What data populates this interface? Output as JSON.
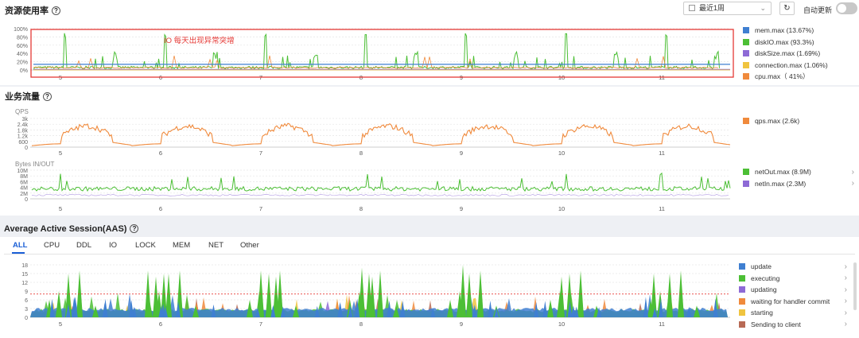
{
  "header": {
    "title": "资源使用率",
    "time_range": "最近1周",
    "auto_refresh_label": "自动更新"
  },
  "resource": {
    "annotation": "IO 每天出现异常突增",
    "y_ticks": [
      "100%",
      "80%",
      "60%",
      "40%",
      "20%",
      "0%"
    ],
    "x_ticks": [
      "5",
      "6",
      "7",
      "8",
      "9",
      "10",
      "11"
    ],
    "legend": [
      {
        "label": "mem.max (13.67%)",
        "color": "#3f7fd1"
      },
      {
        "label": "diskIO.max (93.3%)",
        "color": "#4cbf35"
      },
      {
        "label": "diskSize.max (1.69%)",
        "color": "#8e6ad6"
      },
      {
        "label": "connection.max (1.06%)",
        "color": "#f0c43f"
      },
      {
        "label": "cpu.max（ 41%）",
        "color": "#f08a3c"
      }
    ],
    "highlight_color": "#e53935"
  },
  "traffic": {
    "title": "业务流量",
    "qps_label": "QPS",
    "qps_ticks": [
      "3k",
      "2.4k",
      "1.8k",
      "1.2k",
      "600",
      "0"
    ],
    "bytes_label": "Bytes IN/OUT",
    "bytes_ticks": [
      "10M",
      "8M",
      "6M",
      "4M",
      "2M",
      "0"
    ],
    "x_ticks": [
      "5",
      "6",
      "7",
      "8",
      "9",
      "10",
      "11"
    ],
    "qps_legend": [
      {
        "label": "qps.max (2.6k)",
        "color": "#f08a3c"
      }
    ],
    "bytes_legend": [
      {
        "label": "netOut.max (8.9M)",
        "color": "#4cbf35"
      },
      {
        "label": "netIn.max (2.3M)",
        "color": "#8e6ad6"
      }
    ]
  },
  "aas": {
    "title": "Average Active Session(AAS)",
    "tabs": [
      "ALL",
      "CPU",
      "DDL",
      "IO",
      "LOCK",
      "MEM",
      "NET",
      "Other"
    ],
    "active_tab": "ALL",
    "y_ticks": [
      "18",
      "15",
      "12",
      "9",
      "6",
      "3",
      "0"
    ],
    "x_ticks": [
      "5",
      "6",
      "7",
      "8",
      "9",
      "10",
      "11"
    ],
    "threshold": 8,
    "legend": [
      {
        "label": "update",
        "color": "#3f7fd1"
      },
      {
        "label": "executing",
        "color": "#4cbf35"
      },
      {
        "label": "updating",
        "color": "#8e6ad6"
      },
      {
        "label": "waiting for handler commit",
        "color": "#f08a3c"
      },
      {
        "label": "starting",
        "color": "#f0c43f"
      },
      {
        "label": "Sending to client",
        "color": "#b86a55"
      }
    ]
  }
}
